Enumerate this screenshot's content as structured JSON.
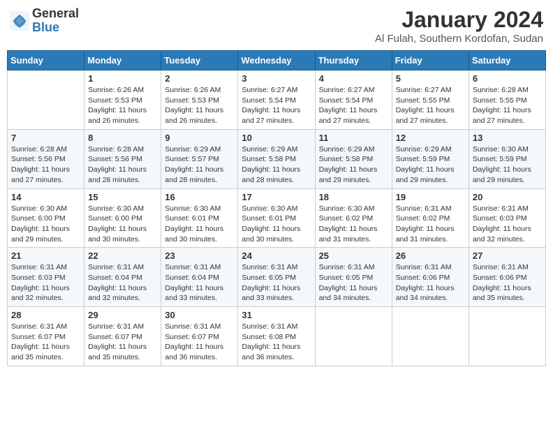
{
  "header": {
    "logo_general": "General",
    "logo_blue": "Blue",
    "month_year": "January 2024",
    "location": "Al Fulah, Southern Kordofan, Sudan"
  },
  "days_of_week": [
    "Sunday",
    "Monday",
    "Tuesday",
    "Wednesday",
    "Thursday",
    "Friday",
    "Saturday"
  ],
  "weeks": [
    [
      {
        "day": "",
        "info": ""
      },
      {
        "day": "1",
        "info": "Sunrise: 6:26 AM\nSunset: 5:53 PM\nDaylight: 11 hours\nand 26 minutes."
      },
      {
        "day": "2",
        "info": "Sunrise: 6:26 AM\nSunset: 5:53 PM\nDaylight: 11 hours\nand 26 minutes."
      },
      {
        "day": "3",
        "info": "Sunrise: 6:27 AM\nSunset: 5:54 PM\nDaylight: 11 hours\nand 27 minutes."
      },
      {
        "day": "4",
        "info": "Sunrise: 6:27 AM\nSunset: 5:54 PM\nDaylight: 11 hours\nand 27 minutes."
      },
      {
        "day": "5",
        "info": "Sunrise: 6:27 AM\nSunset: 5:55 PM\nDaylight: 11 hours\nand 27 minutes."
      },
      {
        "day": "6",
        "info": "Sunrise: 6:28 AM\nSunset: 5:55 PM\nDaylight: 11 hours\nand 27 minutes."
      }
    ],
    [
      {
        "day": "7",
        "info": "Sunrise: 6:28 AM\nSunset: 5:56 PM\nDaylight: 11 hours\nand 27 minutes."
      },
      {
        "day": "8",
        "info": "Sunrise: 6:28 AM\nSunset: 5:56 PM\nDaylight: 11 hours\nand 28 minutes."
      },
      {
        "day": "9",
        "info": "Sunrise: 6:29 AM\nSunset: 5:57 PM\nDaylight: 11 hours\nand 28 minutes."
      },
      {
        "day": "10",
        "info": "Sunrise: 6:29 AM\nSunset: 5:58 PM\nDaylight: 11 hours\nand 28 minutes."
      },
      {
        "day": "11",
        "info": "Sunrise: 6:29 AM\nSunset: 5:58 PM\nDaylight: 11 hours\nand 29 minutes."
      },
      {
        "day": "12",
        "info": "Sunrise: 6:29 AM\nSunset: 5:59 PM\nDaylight: 11 hours\nand 29 minutes."
      },
      {
        "day": "13",
        "info": "Sunrise: 6:30 AM\nSunset: 5:59 PM\nDaylight: 11 hours\nand 29 minutes."
      }
    ],
    [
      {
        "day": "14",
        "info": "Sunrise: 6:30 AM\nSunset: 6:00 PM\nDaylight: 11 hours\nand 29 minutes."
      },
      {
        "day": "15",
        "info": "Sunrise: 6:30 AM\nSunset: 6:00 PM\nDaylight: 11 hours\nand 30 minutes."
      },
      {
        "day": "16",
        "info": "Sunrise: 6:30 AM\nSunset: 6:01 PM\nDaylight: 11 hours\nand 30 minutes."
      },
      {
        "day": "17",
        "info": "Sunrise: 6:30 AM\nSunset: 6:01 PM\nDaylight: 11 hours\nand 30 minutes."
      },
      {
        "day": "18",
        "info": "Sunrise: 6:30 AM\nSunset: 6:02 PM\nDaylight: 11 hours\nand 31 minutes."
      },
      {
        "day": "19",
        "info": "Sunrise: 6:31 AM\nSunset: 6:02 PM\nDaylight: 11 hours\nand 31 minutes."
      },
      {
        "day": "20",
        "info": "Sunrise: 6:31 AM\nSunset: 6:03 PM\nDaylight: 11 hours\nand 32 minutes."
      }
    ],
    [
      {
        "day": "21",
        "info": "Sunrise: 6:31 AM\nSunset: 6:03 PM\nDaylight: 11 hours\nand 32 minutes."
      },
      {
        "day": "22",
        "info": "Sunrise: 6:31 AM\nSunset: 6:04 PM\nDaylight: 11 hours\nand 32 minutes."
      },
      {
        "day": "23",
        "info": "Sunrise: 6:31 AM\nSunset: 6:04 PM\nDaylight: 11 hours\nand 33 minutes."
      },
      {
        "day": "24",
        "info": "Sunrise: 6:31 AM\nSunset: 6:05 PM\nDaylight: 11 hours\nand 33 minutes."
      },
      {
        "day": "25",
        "info": "Sunrise: 6:31 AM\nSunset: 6:05 PM\nDaylight: 11 hours\nand 34 minutes."
      },
      {
        "day": "26",
        "info": "Sunrise: 6:31 AM\nSunset: 6:06 PM\nDaylight: 11 hours\nand 34 minutes."
      },
      {
        "day": "27",
        "info": "Sunrise: 6:31 AM\nSunset: 6:06 PM\nDaylight: 11 hours\nand 35 minutes."
      }
    ],
    [
      {
        "day": "28",
        "info": "Sunrise: 6:31 AM\nSunset: 6:07 PM\nDaylight: 11 hours\nand 35 minutes."
      },
      {
        "day": "29",
        "info": "Sunrise: 6:31 AM\nSunset: 6:07 PM\nDaylight: 11 hours\nand 35 minutes."
      },
      {
        "day": "30",
        "info": "Sunrise: 6:31 AM\nSunset: 6:07 PM\nDaylight: 11 hours\nand 36 minutes."
      },
      {
        "day": "31",
        "info": "Sunrise: 6:31 AM\nSunset: 6:08 PM\nDaylight: 11 hours\nand 36 minutes."
      },
      {
        "day": "",
        "info": ""
      },
      {
        "day": "",
        "info": ""
      },
      {
        "day": "",
        "info": ""
      }
    ]
  ]
}
